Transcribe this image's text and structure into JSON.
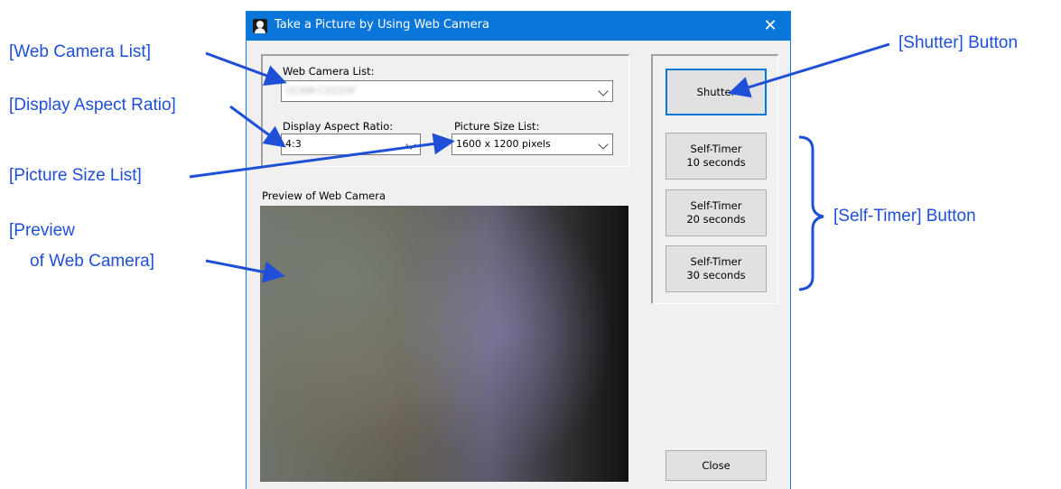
{
  "window": {
    "title": "Take a Picture by Using Web Camera",
    "close_glyph": "✕",
    "icon": "person-silhouette-icon"
  },
  "settings": {
    "web_camera_list_label": "Web Camera List:",
    "web_camera_value": "UCAM-C0220F",
    "display_aspect_ratio_label": "Display Aspect Ratio:",
    "display_aspect_ratio_value": "4:3",
    "picture_size_list_label": "Picture Size List:",
    "picture_size_value": "1600 x 1200 pixels"
  },
  "preview": {
    "label": "Preview of Web Camera"
  },
  "buttons": {
    "shutter": "Shutter",
    "self_timer_10": [
      "Self-Timer",
      "10 seconds"
    ],
    "self_timer_20": [
      "Self-Timer",
      "20 seconds"
    ],
    "self_timer_30": [
      "Self-Timer",
      "30 seconds"
    ],
    "close": "Close"
  },
  "callouts": {
    "web_camera_list": "[Web Camera List]",
    "display_aspect_ratio": "[Display Aspect Ratio]",
    "picture_size_list": "[Picture Size List]",
    "preview_line1": "[Preview",
    "preview_line2": "of Web Camera]",
    "shutter_button": "[Shutter] Button",
    "self_timer_button": "[Self-Timer] Button"
  },
  "colors": {
    "callout_blue": "#1f4fd6",
    "titlebar_blue": "#0b76d9"
  }
}
